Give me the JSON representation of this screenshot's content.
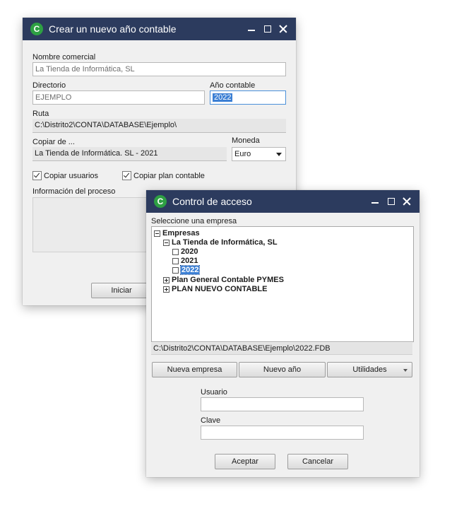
{
  "win1": {
    "title": "Crear un nuevo año contable",
    "logo_letter": "C",
    "nombre_label": "Nombre comercial",
    "nombre_value": "La Tienda de Informática, SL",
    "directorio_label": "Directorio",
    "directorio_value": "EJEMPLO",
    "anio_label": "Año contable",
    "anio_value": "2022",
    "ruta_label": "Ruta",
    "ruta_value": "C:\\Distrito2\\CONTA\\DATABASE\\Ejemplo\\",
    "copiar_label": "Copiar de ...",
    "copiar_value": "La Tienda de Informática. SL - 2021",
    "moneda_label": "Moneda",
    "moneda_value": "Euro",
    "copiar_usuarios": "Copiar usuarios",
    "copiar_plan": "Copiar plan contable",
    "info_label": "Información del proceso",
    "iniciar_label": "Iniciar"
  },
  "win2": {
    "title": "Control de acceso",
    "logo_letter": "C",
    "select_label": "Seleccione una empresa",
    "tree": {
      "root": "Empresas",
      "company": "La Tienda de Informática, SL",
      "years": [
        "2020",
        "2021",
        "2022"
      ],
      "plan_pymes": "Plan General Contable PYMES",
      "plan_nuevo": "PLAN NUEVO CONTABLE"
    },
    "path": "C:\\Distrito2\\CONTA\\DATABASE\\Ejemplo\\2022.FDB",
    "nueva_empresa": "Nueva empresa",
    "nuevo_anio": "Nuevo año",
    "utilidades": "Utilidades",
    "usuario_label": "Usuario",
    "usuario_value": "",
    "clave_label": "Clave",
    "clave_value": "",
    "aceptar": "Aceptar",
    "cancelar": "Cancelar"
  },
  "colors": {
    "titlebar": "#2c3b5e",
    "logo": "#2ea043",
    "selection": "#3b7fd4"
  }
}
